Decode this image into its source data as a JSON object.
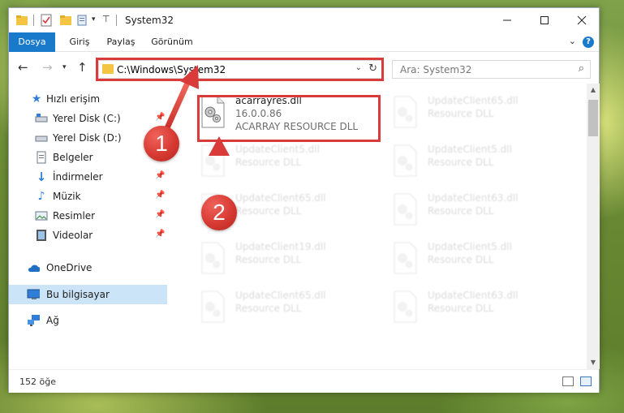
{
  "window": {
    "title": "System32"
  },
  "ribbon": {
    "tabs": [
      {
        "label": "Dosya"
      },
      {
        "label": "Giriş"
      },
      {
        "label": "Paylaş"
      },
      {
        "label": "Görünüm"
      }
    ],
    "help_label": "?"
  },
  "nav": {
    "address": "C:\\Windows\\System32",
    "search_placeholder": "Ara: System32"
  },
  "sidebar": {
    "quick_access": "Hızlı erişim",
    "items": [
      {
        "label": "Yerel Disk (C:)",
        "icon": "drive-c-icon",
        "pinned": true
      },
      {
        "label": "Yerel Disk (D:)",
        "icon": "drive-d-icon",
        "pinned": false
      },
      {
        "label": "Belgeler",
        "icon": "documents-icon",
        "pinned": true
      },
      {
        "label": "İndirmeler",
        "icon": "downloads-icon",
        "pinned": true
      },
      {
        "label": "Müzik",
        "icon": "music-icon",
        "pinned": true
      },
      {
        "label": "Resimler",
        "icon": "pictures-icon",
        "pinned": true
      },
      {
        "label": "Videolar",
        "icon": "videos-icon",
        "pinned": true
      }
    ],
    "onedrive": "OneDrive",
    "this_pc": "Bu bilgisayar",
    "network": "Ağ"
  },
  "files": {
    "highlighted": {
      "name": "acarrayres.dll",
      "version": "16.0.0.86",
      "description": "ACARRAY RESOURCE DLL"
    },
    "faded": [
      {
        "name": "UpdateClient65.dll",
        "description": "Resource DLL"
      },
      {
        "name": "UpdateClient5.dll",
        "description": "Resource DLL"
      },
      {
        "name": "UpdateClient5.dll",
        "description": "Resource DLL"
      },
      {
        "name": "UpdateClient65.dll",
        "description": "Resource DLL"
      },
      {
        "name": "UpdateClient63.dll",
        "description": "Resource DLL"
      },
      {
        "name": "UpdateClient19.dll",
        "description": "Resource DLL"
      },
      {
        "name": "UpdateClient5.dll",
        "description": "Resource DLL"
      },
      {
        "name": "UpdateClient65.dll",
        "description": "Resource DLL"
      },
      {
        "name": "UpdateClient63.dll",
        "description": "Resource DLL"
      }
    ]
  },
  "status": {
    "item_count": "152 öğe"
  },
  "annotations": {
    "step1": "1",
    "step2": "2",
    "color": "#d93a3a"
  }
}
